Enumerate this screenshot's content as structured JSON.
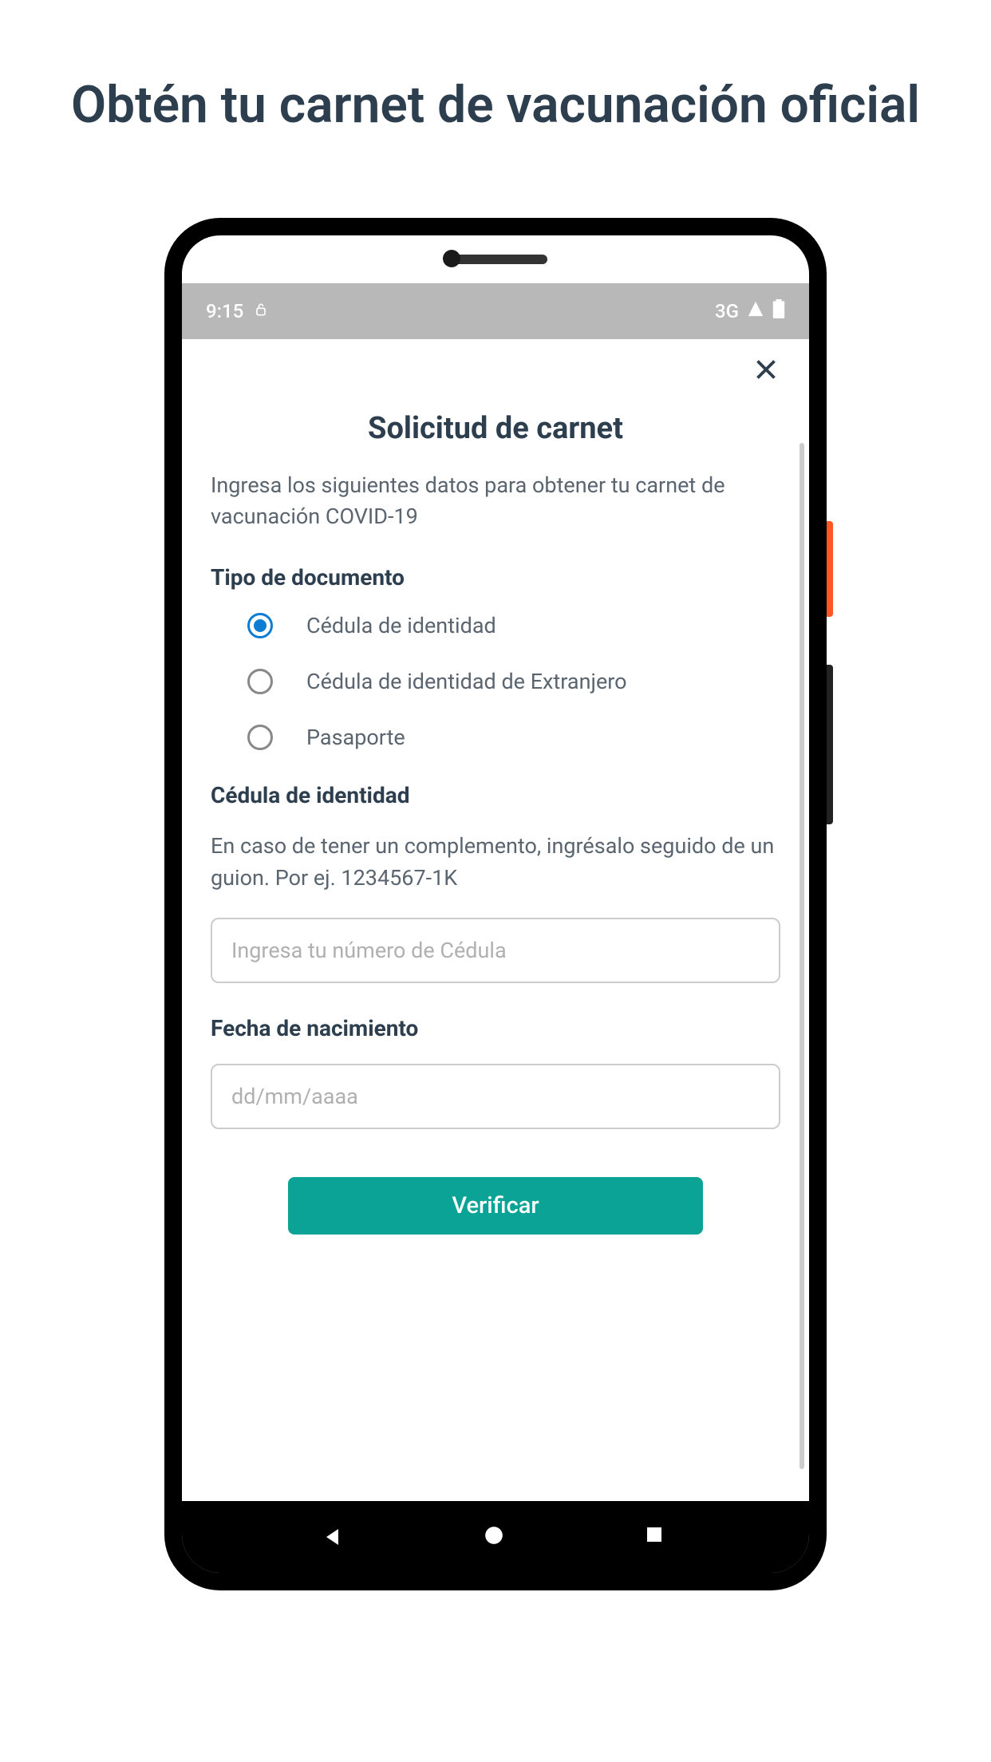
{
  "promo": {
    "title": "Obtén tu carnet de vacunación oficial"
  },
  "statusBar": {
    "time": "9:15",
    "network": "3G"
  },
  "modal": {
    "title": "Solicitud de carnet",
    "description": "Ingresa los siguientes datos para obtener tu carnet de vacunación COVID-19",
    "documentType": {
      "label": "Tipo de documento",
      "options": [
        {
          "label": "Cédula de identidad",
          "selected": true
        },
        {
          "label": "Cédula de identidad de Extranjero",
          "selected": false
        },
        {
          "label": "Pasaporte",
          "selected": false
        }
      ]
    },
    "idSection": {
      "label": "Cédula de identidad",
      "helper": "En caso de tener un complemento, ingrésalo seguido de un guion. Por ej. 1234567-1K",
      "placeholder": "Ingresa tu número de Cédula"
    },
    "birthDate": {
      "label": "Fecha de nacimiento",
      "placeholder": "dd/mm/aaaa"
    },
    "submitLabel": "Verificar"
  }
}
